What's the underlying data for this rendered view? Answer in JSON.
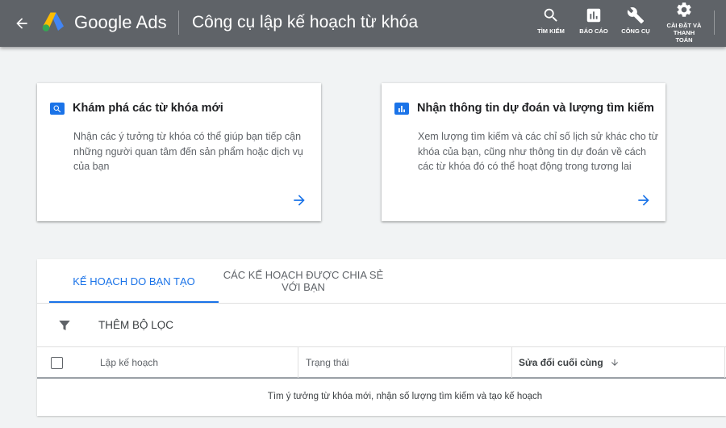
{
  "header": {
    "brand": "Google Ads",
    "page_title": "Công cụ lập kế hoạch từ khóa",
    "actions": {
      "search": "TÌM KIẾM",
      "reports": "BÁO CÁO",
      "tools": "CÔNG CỤ",
      "settings_line1": "CÀI ĐẶT VÀ",
      "settings_line2": "THANH",
      "settings_line3": "TOÁN"
    },
    "icons": {
      "back": "arrow-left-icon",
      "search": "search-icon",
      "reports": "bar-chart-icon",
      "tools": "wrench-icon",
      "settings": "gear-icon"
    }
  },
  "cards": [
    {
      "icon": "search-icon",
      "title": "Khám phá các từ khóa mới",
      "description": "Nhận các ý tưởng từ khóa có thể giúp bạn tiếp cận những người quan tâm đến sản phẩm hoặc dịch vụ của bạn"
    },
    {
      "icon": "bar-chart-icon",
      "title": "Nhận thông tin dự đoán và lượng tìm kiếm",
      "description": "Xem lượng tìm kiếm và các chỉ số lịch sử khác cho từ khóa của bạn, cũng như thông tin dự đoán về cách các từ khóa đó có thể hoạt động trong tương lai"
    }
  ],
  "tabs": [
    {
      "label": "KẾ HOẠCH DO BẠN TẠO",
      "active": true
    },
    {
      "label": "CÁC KẾ HOẠCH ĐƯỢC CHIA SẺ VỚI BẠN",
      "active": false
    }
  ],
  "filter": {
    "label": "THÊM BỘ LỌC",
    "icon": "filter-icon"
  },
  "table": {
    "columns": [
      "Lập kế hoạch",
      "Trạng thái",
      "Sửa đổi cuối cùng"
    ],
    "sort_icon": "arrow-down-icon",
    "empty_message": "Tìm ý tưởng từ khóa mới, nhận số lượng tìm kiếm và tạo kế hoạch"
  },
  "colors": {
    "header_bg": "#5f6368",
    "accent": "#1a73e8",
    "page_bg": "#f1f3f4"
  }
}
